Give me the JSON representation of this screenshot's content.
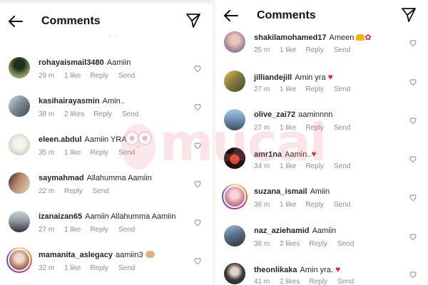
{
  "left_panel": {
    "title": "Comments",
    "partial_text": "· ·",
    "comments": [
      {
        "username": "rohayaismail3480",
        "text": "Aamiin",
        "time": "29 m",
        "likes": "1 like",
        "reply": "Reply",
        "send": "Send"
      },
      {
        "username": "kasihairayasmin",
        "text": "Amin..",
        "time": "38 m",
        "likes": "2 likes",
        "reply": "Reply",
        "send": "Send"
      },
      {
        "username": "eleen.abdul",
        "text": "Aamiin YRA",
        "time": "35 m",
        "likes": "1 like",
        "reply": "Reply",
        "send": "Send"
      },
      {
        "username": "saymahmad",
        "text": "Allahumma Aamiin",
        "time": "22 m",
        "likes": "",
        "reply": "Reply",
        "send": "Send"
      },
      {
        "username": "izanaizan65",
        "text": "Aamiin Allahumma Aamiin",
        "time": "27 m",
        "likes": "1 like",
        "reply": "Reply",
        "send": "Send"
      },
      {
        "username": "mamanita_aslegacy",
        "text": "aamiin3",
        "time": "32 m",
        "likes": "1 like",
        "reply": "Reply",
        "send": "Send"
      }
    ]
  },
  "right_panel": {
    "title": "Comments",
    "comments": [
      {
        "username": "shakilamohamed17",
        "text": "Ameen",
        "time": "25 m",
        "likes": "1 like",
        "reply": "Reply",
        "send": "Send"
      },
      {
        "username": "jilliandejill",
        "text": "Amin yra",
        "time": "27 m",
        "likes": "1 like",
        "reply": "Reply",
        "send": "Send"
      },
      {
        "username": "olive_zai72",
        "text": "aaminnnn",
        "time": "27 m",
        "likes": "1 like",
        "reply": "Reply",
        "send": "Send"
      },
      {
        "username": "amr1na",
        "text": "Aamin..",
        "time": "34 m",
        "likes": "1 like",
        "reply": "Reply",
        "send": "Send"
      },
      {
        "username": "suzana_ismail",
        "text": "Amiin",
        "time": "36 m",
        "likes": "1 like",
        "reply": "Reply",
        "send": "Send"
      },
      {
        "username": "naz_aziehamid",
        "text": "Aamiin",
        "time": "38 m",
        "likes": "2 likes",
        "reply": "Reply",
        "send": "Send"
      },
      {
        "username": "theonlikaka",
        "text": "Amin yra.",
        "time": "41 m",
        "likes": "2 likes",
        "reply": "Reply",
        "send": "Send"
      }
    ]
  },
  "watermark": {
    "text": "mucal"
  },
  "colors": {
    "text": "#262626",
    "meta": "#8e8e8e",
    "heart": "#e8233b",
    "watermark": "#e88296"
  }
}
